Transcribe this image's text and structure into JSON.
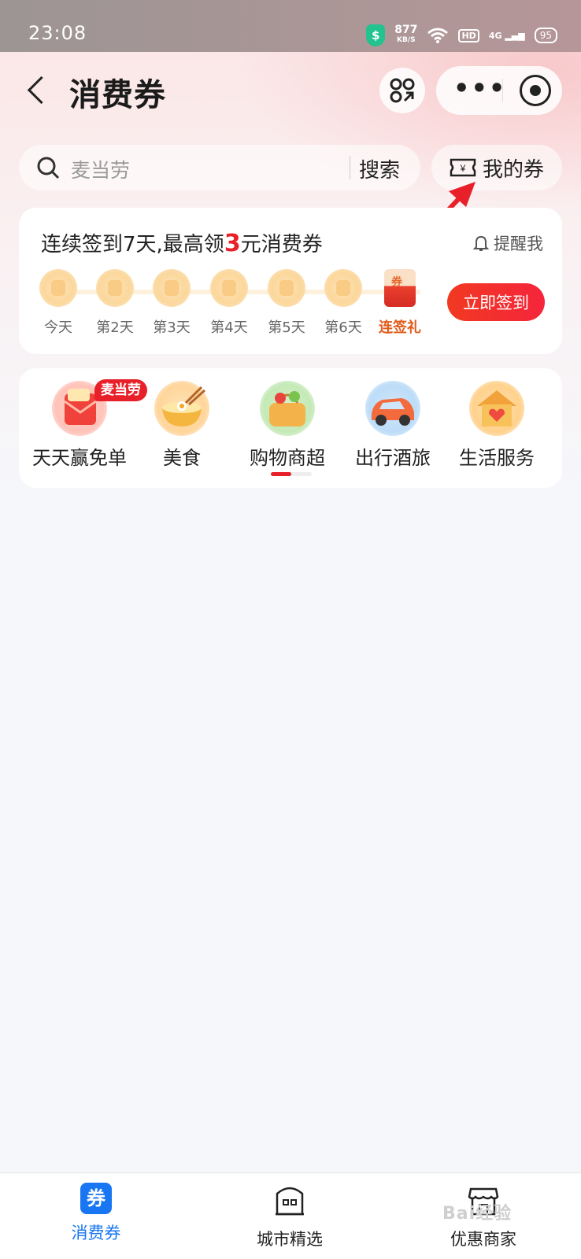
{
  "status_bar": {
    "time": "23:08",
    "net_speed": "877",
    "net_unit": "KB/S",
    "hd": "HD",
    "signal": "4G",
    "battery": "95"
  },
  "header": {
    "title": "消费券"
  },
  "search": {
    "placeholder": "麦当劳",
    "button_label": "搜索",
    "my_coupons_label": "我的券"
  },
  "checkin": {
    "title_prefix": "连续签到7天,最高领",
    "title_amount": "3",
    "title_suffix": "元消费券",
    "remind_label": "提醒我",
    "days": [
      "今天",
      "第2天",
      "第3天",
      "第4天",
      "第5天",
      "第6天"
    ],
    "gift_label": "连签礼",
    "gift_icon_text": "券",
    "button_label": "立即签到"
  },
  "categories": {
    "items": [
      {
        "label": "天天赢免单",
        "icon": "free-order-envelope-icon",
        "badge": "麦当劳"
      },
      {
        "label": "美食",
        "icon": "noodle-bowl-icon"
      },
      {
        "label": "购物商超",
        "icon": "shopping-basket-icon"
      },
      {
        "label": "出行酒旅",
        "icon": "car-icon"
      },
      {
        "label": "生活服务",
        "icon": "house-heart-icon"
      }
    ],
    "page_indicator": "1/2"
  },
  "tabbar": {
    "items": [
      {
        "label": "消费券",
        "icon": "coupon-icon",
        "active": true,
        "icon_text": "券"
      },
      {
        "label": "城市精选",
        "icon": "building-icon",
        "active": false
      },
      {
        "label": "优惠商家",
        "icon": "storefront-icon",
        "active": false
      }
    ]
  },
  "watermark": "Bai经验",
  "colors": {
    "accent_red": "#e8202a",
    "tab_active_blue": "#1976f2",
    "annotation_arrow": "#e8202a"
  }
}
